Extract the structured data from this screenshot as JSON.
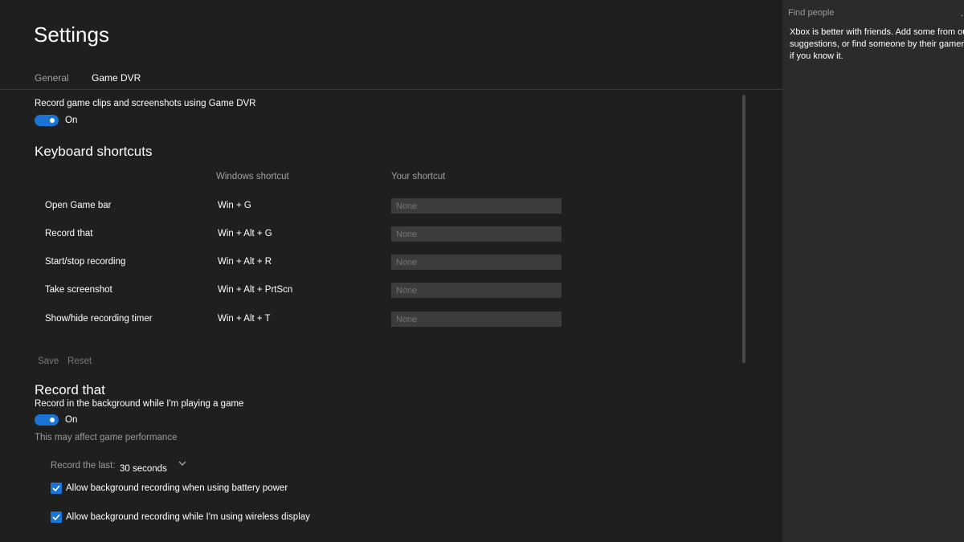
{
  "page": {
    "title": "Settings"
  },
  "tabs": [
    {
      "label": "General",
      "selected": false
    },
    {
      "label": "Game DVR",
      "selected": true
    }
  ],
  "game_dvr": {
    "record_label": "Record game clips and screenshots using Game DVR",
    "toggle_state": "On"
  },
  "keyboard_shortcuts": {
    "heading": "Keyboard shortcuts",
    "col_windows": "Windows shortcut",
    "col_yours": "Your shortcut",
    "rows": [
      {
        "action": "Open Game bar",
        "windows": "Win + G",
        "yours": "None"
      },
      {
        "action": "Record that",
        "windows": "Win + Alt + G",
        "yours": "None"
      },
      {
        "action": "Start/stop recording",
        "windows": "Win + Alt + R",
        "yours": "None"
      },
      {
        "action": "Take screenshot",
        "windows": "Win + Alt + PrtScn",
        "yours": "None"
      },
      {
        "action": "Show/hide recording timer",
        "windows": "Win + Alt + T",
        "yours": "None"
      }
    ],
    "save_label": "Save",
    "reset_label": "Reset"
  },
  "record_that": {
    "heading": "Record that",
    "background_label": "Record in the background while I'm playing a game",
    "toggle_state": "On",
    "perf_note": "This may affect game performance",
    "record_last_label": "Record the last:",
    "record_last_value": "30 seconds",
    "battery_label": "Allow background recording when using battery power",
    "battery_checked": true,
    "wireless_label": "Allow background recording while I'm using wireless display",
    "wireless_checked": true
  },
  "side_panel": {
    "search_placeholder": "Find people",
    "friends_text": "Xbox is better with friends. Add some from our suggestions, or find someone by their gamertag if you know it."
  },
  "colors": {
    "accent": "#1a74d6",
    "background": "#1f1f1f",
    "panel": "#2b2b2b",
    "input": "#3c3c3c"
  },
  "icons": {
    "checkbox": "checkmark-icon",
    "dropdown": "chevron-down-icon"
  }
}
